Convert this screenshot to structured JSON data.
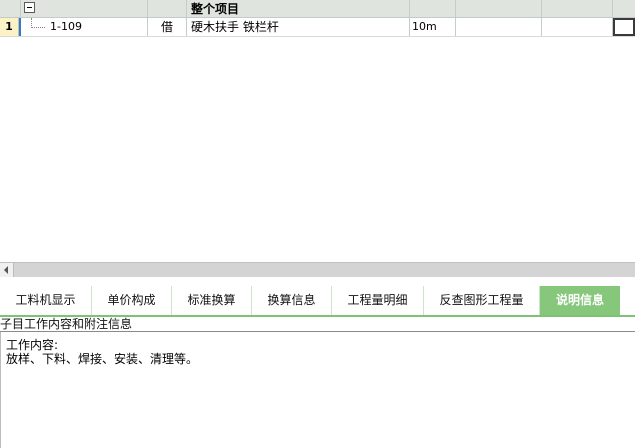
{
  "grid": {
    "header": {
      "title": "整个项目"
    },
    "rows": [
      {
        "num": "1",
        "code": "1-109",
        "type": "借",
        "name": "硬木扶手 铁栏杆",
        "unit": "10m"
      }
    ]
  },
  "tabs": [
    {
      "label": "工料机显示"
    },
    {
      "label": "单价构成"
    },
    {
      "label": "标准换算"
    },
    {
      "label": "换算信息"
    },
    {
      "label": "工程量明细"
    },
    {
      "label": "反查图形工程量"
    },
    {
      "label": "说明信息",
      "active": true
    }
  ],
  "panel": {
    "title": "子目工作内容和附注信息",
    "work_label": "工作内容:",
    "work_content": "放样、下料、焊接、安装、清理等。"
  },
  "colors": {
    "accent": "#86c77c",
    "header_bg": "#dfe4df",
    "rownum_bg": "#fbf3c6"
  }
}
